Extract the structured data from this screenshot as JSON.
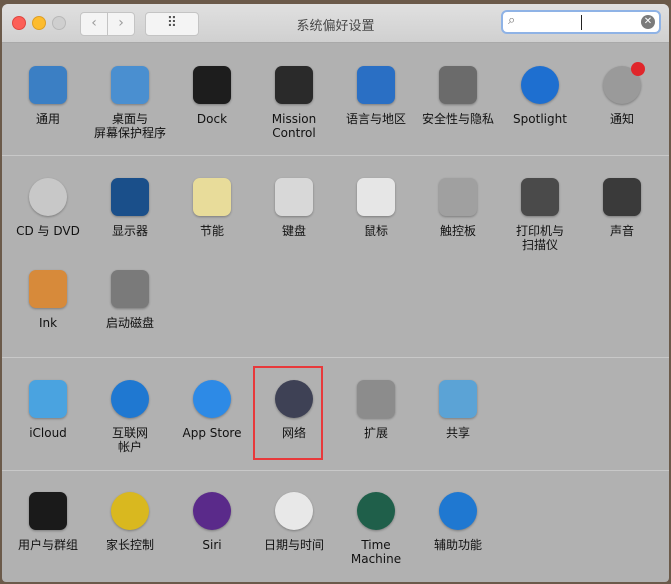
{
  "window": {
    "title": "系统偏好设置"
  },
  "toolbar": {
    "back": "‹",
    "forward": "›",
    "grid": "⠿",
    "search_value": "",
    "search_placeholder": ""
  },
  "sections": [
    {
      "items": [
        {
          "label": "通用",
          "icon": "general-icon",
          "color": "#3b7fc4"
        },
        {
          "label": "桌面与\n屏幕保护程序",
          "icon": "desktop-icon",
          "color": "#4a8fd0"
        },
        {
          "label": "Dock",
          "icon": "dock-icon",
          "color": "#1d1d1d"
        },
        {
          "label": "Mission\nControl",
          "icon": "mission-control-icon",
          "color": "#2a2a2a"
        },
        {
          "label": "语言与地区",
          "icon": "flag-icon",
          "color": "#2a6fc4"
        },
        {
          "label": "安全性与隐私",
          "icon": "house-lock-icon",
          "color": "#6b6b6b"
        },
        {
          "label": "Spotlight",
          "icon": "magnifier-icon",
          "color": "#1e6fd0"
        },
        {
          "label": "通知",
          "icon": "notification-icon",
          "color": "#9a9a9a"
        }
      ]
    },
    {
      "items": [
        {
          "label": "CD 与 DVD",
          "icon": "disc-icon",
          "color": "#c8c8c8"
        },
        {
          "label": "显示器",
          "icon": "display-icon",
          "color": "#1a4f8a"
        },
        {
          "label": "节能",
          "icon": "bulb-icon",
          "color": "#e8dc9a"
        },
        {
          "label": "键盘",
          "icon": "keyboard-icon",
          "color": "#d8d8d8"
        },
        {
          "label": "鼠标",
          "icon": "mouse-icon",
          "color": "#e6e6e6"
        },
        {
          "label": "触控板",
          "icon": "trackpad-icon",
          "color": "#a0a0a0"
        },
        {
          "label": "打印机与\n扫描仪",
          "icon": "printer-icon",
          "color": "#4a4a4a"
        },
        {
          "label": "声音",
          "icon": "speaker-icon",
          "color": "#3a3a3a"
        },
        {
          "label": "Ink",
          "icon": "ink-icon",
          "color": "#d78a3a"
        },
        {
          "label": "启动磁盘",
          "icon": "disk-icon",
          "color": "#7a7a7a"
        }
      ]
    },
    {
      "items": [
        {
          "label": "iCloud",
          "icon": "cloud-icon",
          "color": "#4aa3e0"
        },
        {
          "label": "互联网\n帐户",
          "icon": "at-icon",
          "color": "#1f78d1"
        },
        {
          "label": "App Store",
          "icon": "app-store-icon",
          "color": "#2d8ae6"
        },
        {
          "label": "网络",
          "icon": "globe-icon",
          "color": "#3e4155"
        },
        {
          "label": "扩展",
          "icon": "puzzle-icon",
          "color": "#8c8c8c"
        },
        {
          "label": "共享",
          "icon": "folder-icon",
          "color": "#5ba3d6"
        }
      ]
    },
    {
      "items": [
        {
          "label": "用户与群组",
          "icon": "users-icon",
          "color": "#1a1a1a"
        },
        {
          "label": "家长控制",
          "icon": "parental-icon",
          "color": "#d9b81f"
        },
        {
          "label": "Siri",
          "icon": "siri-icon",
          "color": "#5a2a8a"
        },
        {
          "label": "日期与时间",
          "icon": "clock-icon",
          "color": "#e8e8e8"
        },
        {
          "label": "Time Machine",
          "icon": "time-machine-icon",
          "color": "#1f5f4a"
        },
        {
          "label": "辅助功能",
          "icon": "accessibility-icon",
          "color": "#1f78d1"
        }
      ]
    }
  ],
  "highlight": {
    "item": "网络",
    "color": "#e8393b"
  }
}
